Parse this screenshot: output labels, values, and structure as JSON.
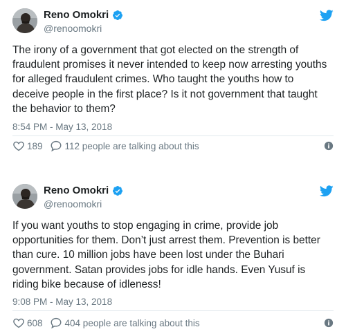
{
  "tweets": [
    {
      "author_name": "Reno Omokri",
      "handle": "@renoomokri",
      "text": "The irony of a government that got elected on the strength of fraudulent promises it never intended to keep now arresting youths for alleged fraudulent crimes. Who taught the youths how to deceive people in the first place? Is it not government that taught the behavior to them?",
      "timestamp": "8:54 PM - May 13, 2018",
      "likes": "189",
      "talking": "112 people are talking about this"
    },
    {
      "author_name": "Reno Omokri",
      "handle": "@renoomokri",
      "text": "If you want youths to stop engaging in crime, provide job opportunities for them. Don’t just arrest them. Prevention is better than cure. 10 million jobs have been lost under the Buhari government. Satan provides jobs for idle hands. Even Yusuf is riding bike because of idleness!",
      "timestamp": "9:08 PM - May 13, 2018",
      "likes": "608",
      "talking": "404 people are talking about this"
    }
  ],
  "colors": {
    "twitter_blue": "#1da1f2",
    "secondary_text": "#697882",
    "divider": "#e1e8ed"
  },
  "icons": [
    "avatar",
    "verified-badge-icon",
    "twitter-bird-icon",
    "heart-icon",
    "comment-bubble-icon",
    "info-icon"
  ]
}
